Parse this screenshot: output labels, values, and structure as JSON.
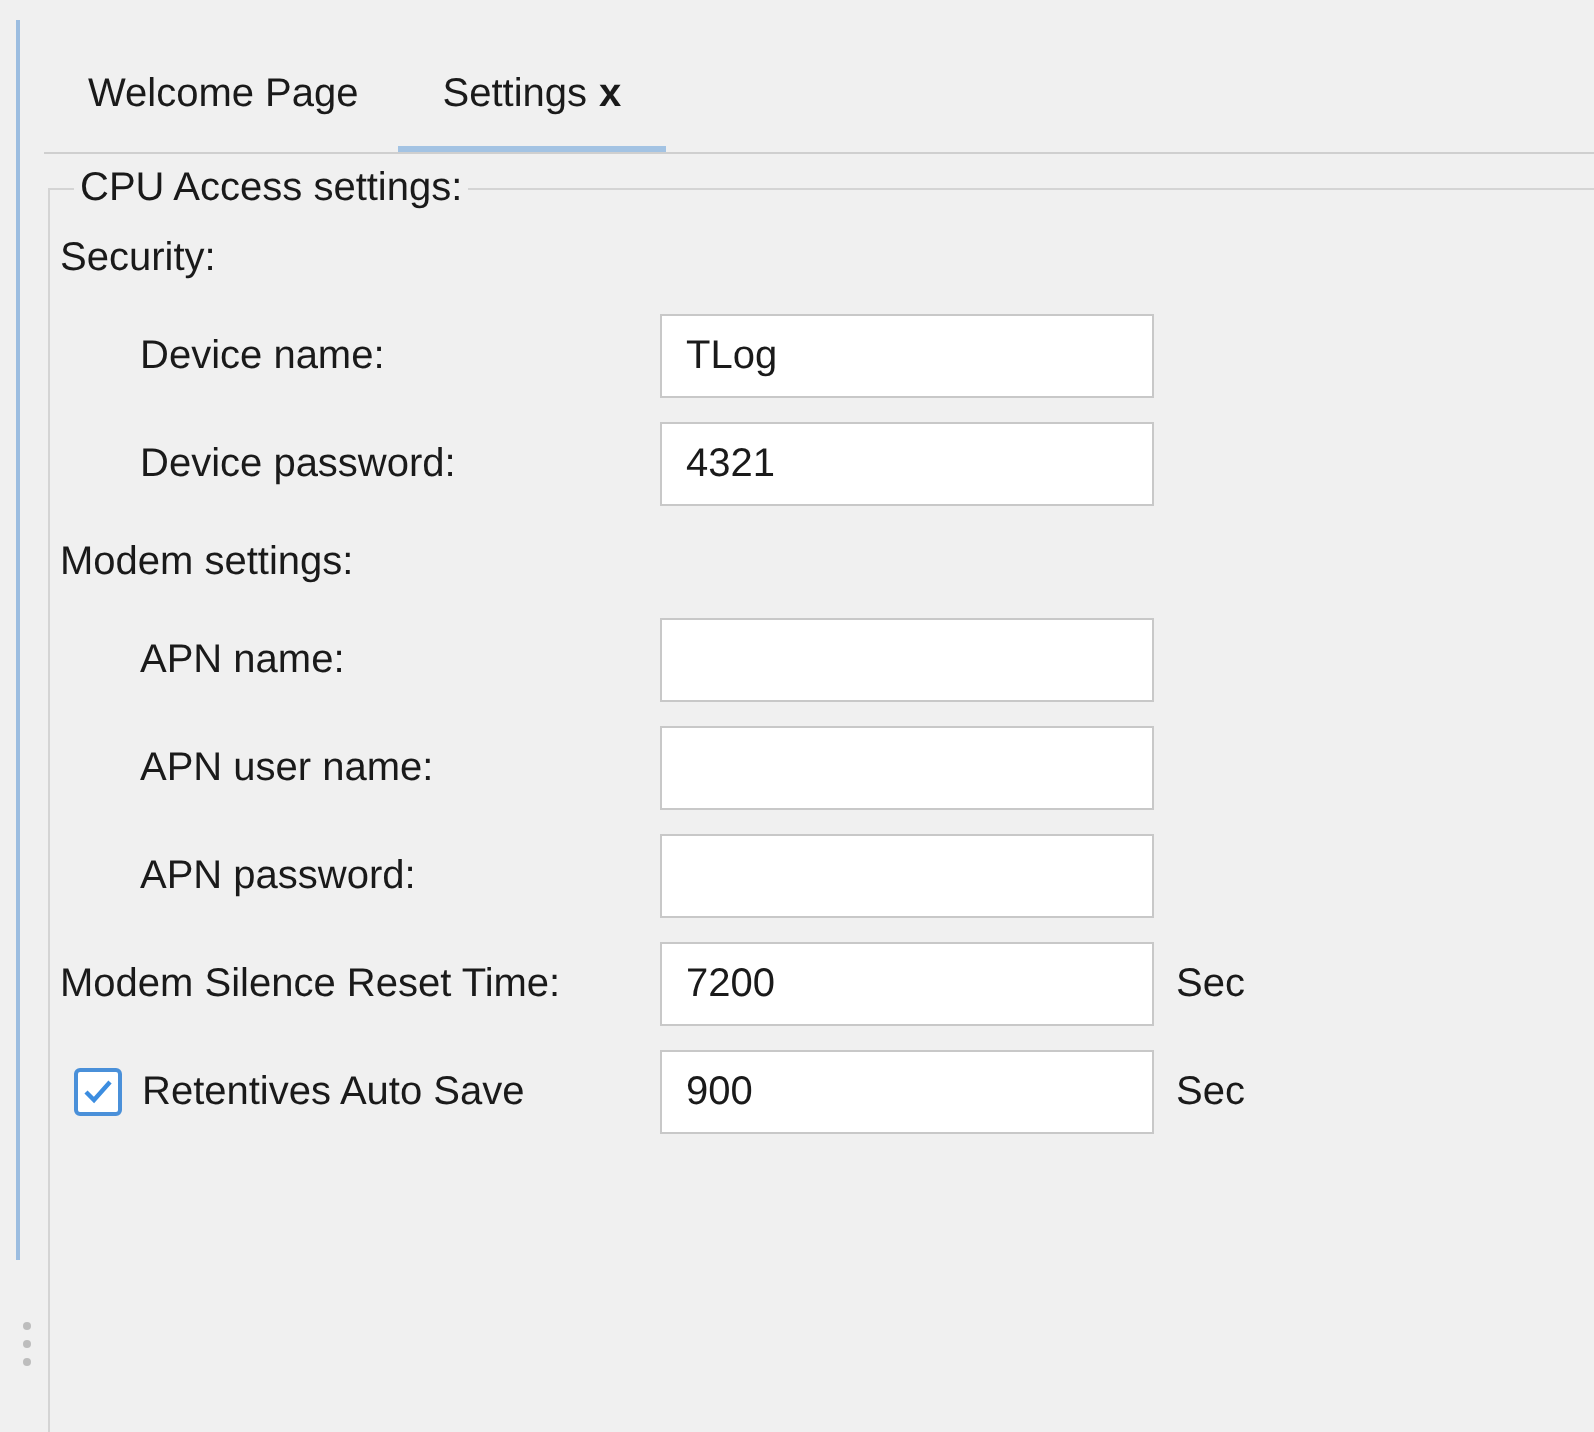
{
  "tabs": [
    {
      "label": "Welcome Page",
      "selected": false
    },
    {
      "label": "Settings",
      "selected": true,
      "close": "x"
    }
  ],
  "group": {
    "title": "CPU Access settings:",
    "rows": [
      {
        "kind": "heading",
        "label": "Security:",
        "children": [
          {
            "kind": "field",
            "label": "Device name:",
            "value": "TLog"
          },
          {
            "kind": "field",
            "label": "Device password:",
            "value": "4321"
          }
        ]
      },
      {
        "kind": "heading",
        "label": "Modem settings:",
        "children": [
          {
            "kind": "field",
            "label": "APN name:"
          },
          {
            "kind": "field",
            "label": "APN user name:"
          },
          {
            "kind": "field",
            "label": "APN password:"
          }
        ]
      },
      {
        "kind": "field",
        "label": "Modem Silence Reset Time:",
        "value": "7200",
        "unit": "Sec"
      },
      {
        "kind": "checkfield",
        "label": "Retentives Auto Save",
        "checked": true,
        "value": "900",
        "unit": "Sec"
      }
    ]
  }
}
